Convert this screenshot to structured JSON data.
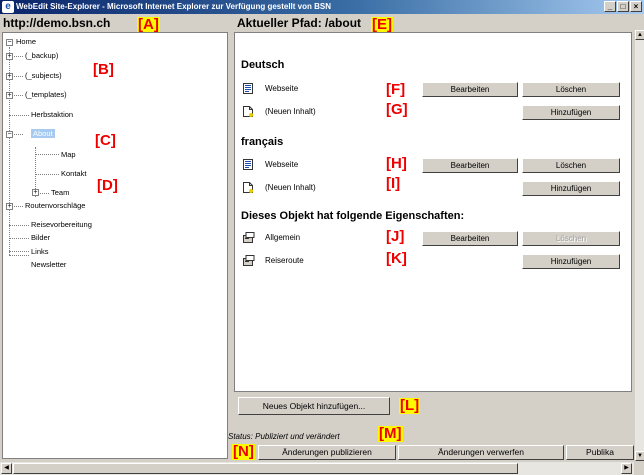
{
  "window": {
    "title": "WebEdit Site-Explorer - Microsoft Internet Explorer  zur Verfügung gestellt von BSN",
    "buttons": [
      "_",
      "□",
      "×"
    ]
  },
  "left": {
    "site_url": "http://demo.bsn.ch",
    "tree": [
      "Home",
      "(_backup)",
      "(_subjects)",
      "(_templates)",
      "Herbstaktion",
      "About",
      "Map",
      "Kontakt",
      "Team",
      "Routenvorschläge",
      "Reisevorbereitung",
      "Bilder",
      "Links",
      "Newsletter"
    ]
  },
  "right": {
    "path_title": "Aktueller Pfad: /about",
    "sections": [
      {
        "title": "Deutsch",
        "rows": [
          {
            "label": "Webseite",
            "buttons": [
              "Bearbeiten",
              "Löschen"
            ]
          },
          {
            "label": "(Neuen Inhalt)",
            "buttons": [
              "Hinzufügen"
            ]
          }
        ]
      },
      {
        "title": "français",
        "rows": [
          {
            "label": "Webseite",
            "buttons": [
              "Bearbeiten",
              "Löschen"
            ]
          },
          {
            "label": "(Neuen Inhalt)",
            "buttons": [
              "Hinzufügen"
            ]
          }
        ]
      },
      {
        "title": "Dieses Objekt hat folgende Eigenschaften:",
        "rows": [
          {
            "label": "Allgemein",
            "buttons": [
              "Bearbeiten",
              "Löschen"
            ]
          },
          {
            "label": "Reiseroute",
            "buttons": [
              "Hinzufügen"
            ]
          }
        ]
      }
    ],
    "new_object_button": "Neues Objekt hinzufügen...",
    "status": "Status: Publiziert und verändert",
    "bottom_buttons": [
      "Änderungen publizieren",
      "Änderungen verwerfen",
      "Publika"
    ]
  },
  "markers": [
    "[A]",
    "[B]",
    "[C]",
    "[D]",
    "[E]",
    "[F]",
    "[G]",
    "[H]",
    "[I]",
    "[J]",
    "[K]",
    "[L]",
    "[M]",
    "[N]"
  ],
  "colors": {
    "marker_red": "#ee0000",
    "marker_yellow": "#fffa00",
    "title_blue": "#0a246a",
    "selection": "#a6caf0"
  }
}
